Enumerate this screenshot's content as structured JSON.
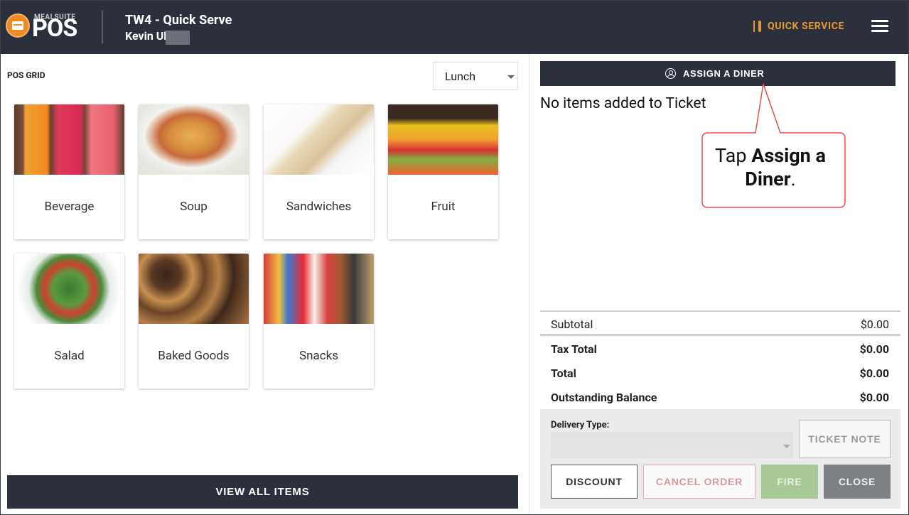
{
  "header": {
    "brand_small": "MEALSUITE",
    "brand_big": "POS",
    "station": "TW4 - Quick Serve",
    "user": "Kevin Uh",
    "mode": "QUICK SERVICE"
  },
  "grid": {
    "label": "POS GRID",
    "meal": "Lunch",
    "categories": [
      "Beverage",
      "Soup",
      "Sandwiches",
      "Fruit",
      "Salad",
      "Baked Goods",
      "Snacks"
    ],
    "view_all": "VIEW ALL ITEMS"
  },
  "ticket": {
    "assign_label": "ASSIGN A DINER",
    "empty_message": "No items added to Ticket",
    "callout": {
      "prefix": "Tap ",
      "bold": "Assign a Diner",
      "suffix": "."
    },
    "totals": {
      "subtotal_label": "Subtotal",
      "subtotal": "$0.00",
      "tax_label": "Tax Total",
      "tax": "$0.00",
      "total_label": "Total",
      "total": "$0.00",
      "balance_label": "Outstanding Balance",
      "balance": "$0.00"
    },
    "delivery_label": "Delivery Type:",
    "ticket_note": "TICKET NOTE",
    "buttons": {
      "discount": "DISCOUNT",
      "cancel": "CANCEL ORDER",
      "fire": "FIRE",
      "close": "CLOSE"
    }
  },
  "colors": {
    "header_bg": "#2b303c",
    "accent_orange": "#e59a2f",
    "callout_red": "#e05050",
    "fire_green": "#a8c996",
    "close_gray": "#7d8084"
  },
  "icons": [
    "mealsuite-logo-icon",
    "fork-knife-icon",
    "hamburger-menu-icon",
    "person-circle-icon",
    "chevron-down-icon"
  ]
}
